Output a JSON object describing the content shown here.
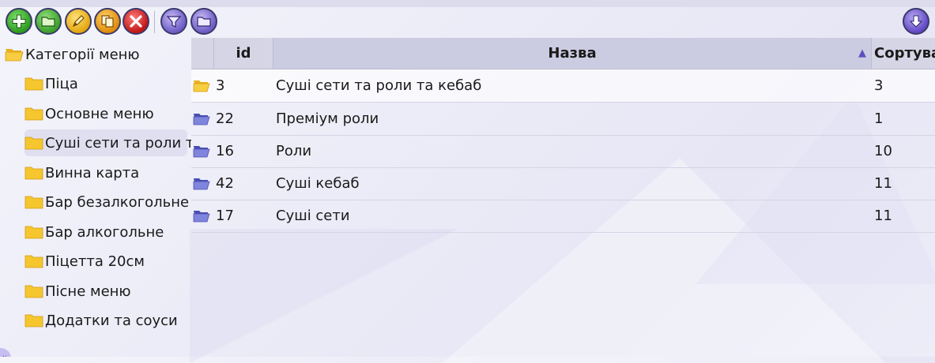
{
  "toolbar": {
    "buttons": [
      "add",
      "folder",
      "edit",
      "copy",
      "delete",
      "filter",
      "open",
      "download"
    ]
  },
  "tree": {
    "root": "Категорії меню",
    "items": [
      {
        "label": "Піца"
      },
      {
        "label": "Основне меню"
      },
      {
        "label": "Суші сети та роли та кебаб",
        "selected": true
      },
      {
        "label": "Винна карта"
      },
      {
        "label": "Бар безалкогольне"
      },
      {
        "label": "Бар алкогольне"
      },
      {
        "label": "Піцетта 20см"
      },
      {
        "label": "Пісне меню"
      },
      {
        "label": "Додатки та соуси"
      }
    ],
    "collapse_label": "«"
  },
  "grid": {
    "columns": {
      "id": "id",
      "name": "Назва",
      "sort": "Сортування"
    },
    "sort_indicator": "▲",
    "rows": [
      {
        "icon": "folder-open-yellow-icon",
        "id": "3",
        "name": "Суші сети та роли та кебаб",
        "sort": "3"
      },
      {
        "icon": "folder-open-blue-icon",
        "id": "22",
        "name": "Преміум роли",
        "sort": "1"
      },
      {
        "icon": "folder-open-blue-icon",
        "id": "16",
        "name": "Роли",
        "sort": "10"
      },
      {
        "icon": "folder-open-blue-icon",
        "id": "42",
        "name": "Суші кебаб",
        "sort": "11"
      },
      {
        "icon": "folder-open-blue-icon",
        "id": "17",
        "name": "Суші сети",
        "sort": "11"
      }
    ]
  },
  "colors": {
    "folder_yellow": "#f5c62e",
    "folder_blue": "#6a6fd0",
    "header_bg": "#d5d5e6",
    "accent_purple": "#6048c4"
  }
}
